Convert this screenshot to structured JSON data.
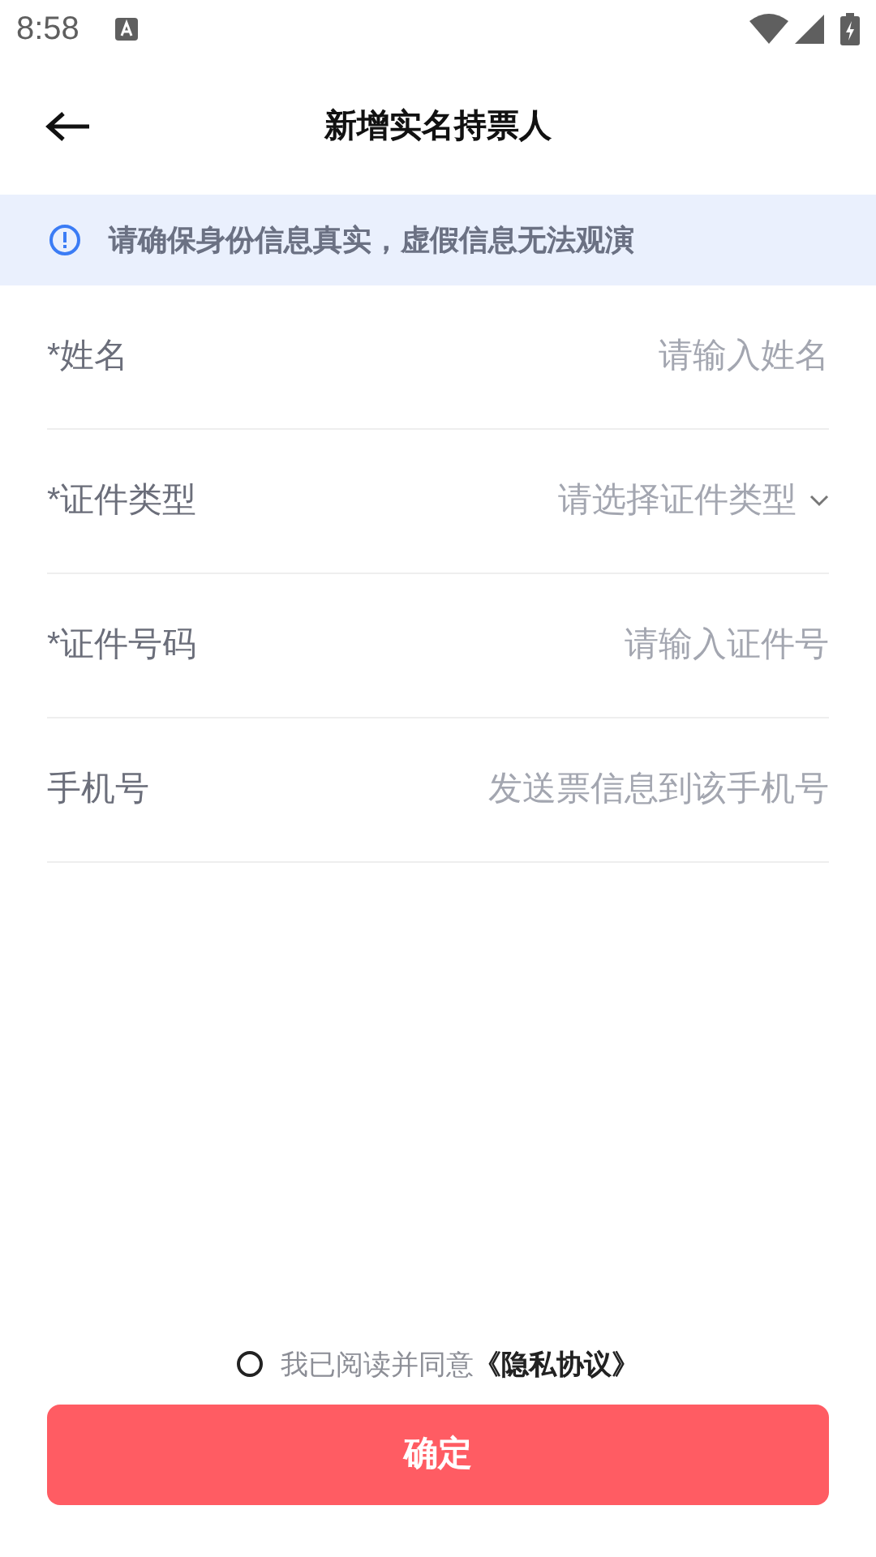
{
  "status_bar": {
    "time": "8:58"
  },
  "header": {
    "title": "新增实名持票人"
  },
  "notice": {
    "text": "请确保身份信息真实，虚假信息无法观演"
  },
  "fields": [
    {
      "kind": "text",
      "label": "*姓名",
      "placeholder": "请输入姓名"
    },
    {
      "kind": "select",
      "label": "*证件类型",
      "placeholder": "请选择证件类型"
    },
    {
      "kind": "text",
      "label": "*证件号码",
      "placeholder": "请输入证件号"
    },
    {
      "kind": "text",
      "label": "手机号",
      "placeholder": "发送票信息到该手机号"
    }
  ],
  "agreement": {
    "checked": false,
    "text": "我已阅读并同意",
    "link": "《隐私协议》"
  },
  "confirm_button": {
    "label": "确定"
  }
}
